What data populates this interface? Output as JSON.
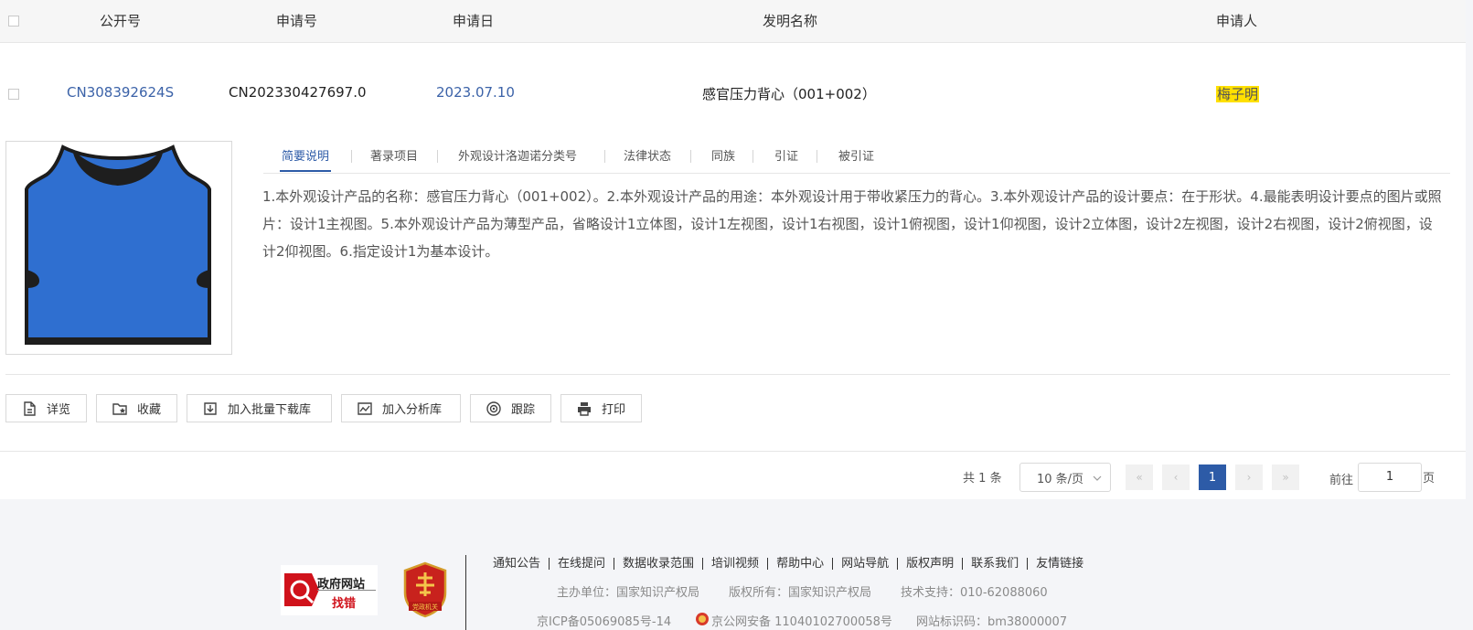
{
  "table": {
    "headers": [
      "公开号",
      "申请号",
      "申请日",
      "发明名称",
      "申请人"
    ],
    "row": {
      "pub_no": "CN308392624S",
      "app_no": "CN202330427697.0",
      "app_date": "2023.07.10",
      "title": "感官压力背心（001+002）",
      "applicant": "梅子明"
    }
  },
  "tabs": [
    "简要说明",
    "著录项目",
    "外观设计洛迦诺分类号",
    "法律状态",
    "同族",
    "引证",
    "被引证"
  ],
  "description": "1.本外观设计产品的名称：感官压力背心（001+002）。2.本外观设计产品的用途：本外观设计用于带收紧压力的背心。3.本外观设计产品的设计要点：在于形状。4.最能表明设计要点的图片或照片：设计1主视图。5.本外观设计产品为薄型产品，省略设计1立体图，设计1左视图，设计1右视图，设计1俯视图，设计1仰视图，设计2立体图，设计2左视图，设计2右视图，设计2俯视图，设计2仰视图。6.指定设计1为基本设计。",
  "actions": [
    {
      "label": "详览",
      "icon": "document-icon"
    },
    {
      "label": "收藏",
      "icon": "folder-star-icon"
    },
    {
      "label": "加入批量下载库",
      "icon": "download-icon"
    },
    {
      "label": "加入分析库",
      "icon": "chart-icon"
    },
    {
      "label": "跟踪",
      "icon": "track-icon"
    },
    {
      "label": "打印",
      "icon": "printer-icon"
    }
  ],
  "pagination": {
    "total_prefix": "共",
    "total": "1",
    "total_suffix": "条",
    "page_size": "10 条/页",
    "first": "«",
    "prev": "‹",
    "current": "1",
    "next": "›",
    "last": "»",
    "goto_prefix": "前往",
    "goto_value": "1",
    "goto_suffix": "页"
  },
  "footer": {
    "badge1_line1": "政府网站",
    "badge1_line2": "找错",
    "badge2_text": "党政机关",
    "links": [
      "通知公告",
      "在线提问",
      "数据收录范围",
      "培训视频",
      "帮助中心",
      "网站导航",
      "版权声明",
      "联系我们",
      "友情链接"
    ],
    "host": "主办单位：国家知识产权局",
    "copyright": "版权所有：国家知识产权局",
    "support": "技术支持：010-62088060",
    "icp": "京ICP备05069085号-14",
    "police": "京公网安备 11040102700058号",
    "site_id": "网站标识码：bm38000007"
  },
  "colors": {
    "accent": "#2d5ba7",
    "link": "#3b62a8",
    "highlight": "#ffe000",
    "vest": "#2f6fd0"
  }
}
